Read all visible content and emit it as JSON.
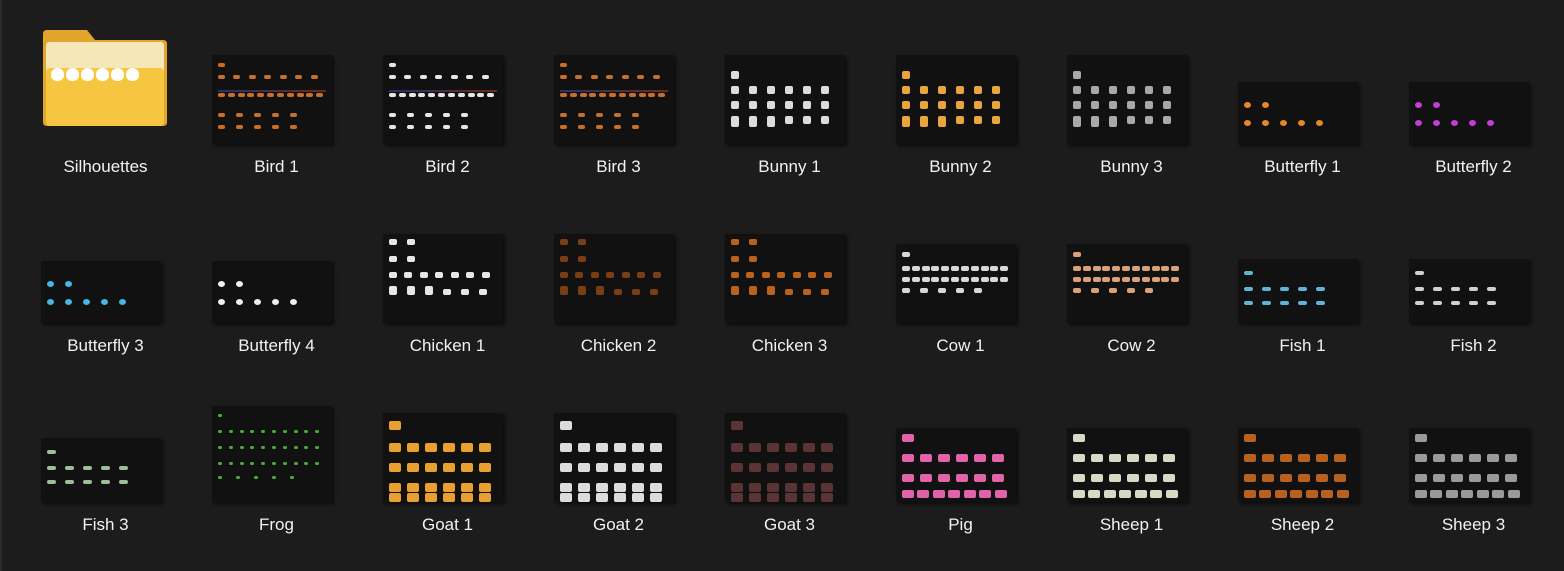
{
  "items": [
    {
      "label": "Silhouettes",
      "type": "folder",
      "color": "#ffffff"
    },
    {
      "label": "Bird 1",
      "type": "bird",
      "color": "#c8702a",
      "accent": "#2a2f6a"
    },
    {
      "label": "Bird 2",
      "type": "bird",
      "color": "#e6e6e6",
      "accent": "#2a2f6a"
    },
    {
      "label": "Bird 3",
      "type": "bird",
      "color": "#c8702a",
      "accent": "#2a2f6a"
    },
    {
      "label": "Bunny 1",
      "type": "bunny",
      "color": "#dcdcdc"
    },
    {
      "label": "Bunny 2",
      "type": "bunny",
      "color": "#e8a53c"
    },
    {
      "label": "Bunny 3",
      "type": "bunny",
      "color": "#a8a8a8"
    },
    {
      "label": "Butterfly 1",
      "type": "butterfly",
      "color": "#e8872a"
    },
    {
      "label": "Butterfly 2",
      "type": "butterfly",
      "color": "#c83cd6"
    },
    {
      "label": "Butterfly 3",
      "type": "butterfly",
      "color": "#46b6e6"
    },
    {
      "label": "Butterfly 4",
      "type": "butterfly",
      "color": "#f0f0f0"
    },
    {
      "label": "Chicken 1",
      "type": "chicken",
      "color": "#e6e6e6"
    },
    {
      "label": "Chicken 2",
      "type": "chicken",
      "color": "#7a3e14"
    },
    {
      "label": "Chicken 3",
      "type": "chicken",
      "color": "#b8621e"
    },
    {
      "label": "Cow 1",
      "type": "cow",
      "color": "#d8d8d8"
    },
    {
      "label": "Cow 2",
      "type": "cow",
      "color": "#d9a07a"
    },
    {
      "label": "Fish 1",
      "type": "fish",
      "color": "#5fb4d4"
    },
    {
      "label": "Fish 2",
      "type": "fish",
      "color": "#d0d0d0"
    },
    {
      "label": "Fish 3",
      "type": "fish",
      "color": "#9bbf9b"
    },
    {
      "label": "Frog",
      "type": "frog",
      "color": "#4caa3c"
    },
    {
      "label": "Goat 1",
      "type": "goat",
      "color": "#e8a032"
    },
    {
      "label": "Goat 2",
      "type": "goat",
      "color": "#dcdcdc"
    },
    {
      "label": "Goat 3",
      "type": "goat",
      "color": "#5a3434"
    },
    {
      "label": "Pig",
      "type": "pig",
      "color": "#e062a8"
    },
    {
      "label": "Sheep 1",
      "type": "sheep",
      "color": "#d6d9c4"
    },
    {
      "label": "Sheep 2",
      "type": "sheep",
      "color": "#b8601e"
    },
    {
      "label": "Sheep 3",
      "type": "sheep",
      "color": "#9a9a9a"
    }
  ],
  "folder_color": "#f7c640"
}
